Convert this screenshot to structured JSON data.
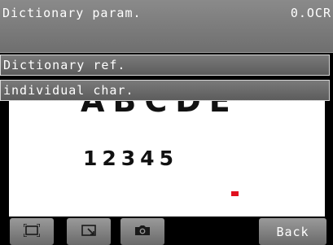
{
  "header": {
    "title": "Dictionary param.",
    "mode": "0.OCR"
  },
  "menu": {
    "items": [
      {
        "label": "Dictionary ref."
      },
      {
        "label": "individual char."
      }
    ]
  },
  "image": {
    "top_chars": "ABCDE",
    "bottom_chars": "12345",
    "marker_color": "#e0101e"
  },
  "toolbar": {
    "buttons": [
      {
        "icon": "fit-frame-icon"
      },
      {
        "icon": "select-region-icon"
      },
      {
        "icon": "camera-icon"
      }
    ],
    "back_label": "Back"
  }
}
